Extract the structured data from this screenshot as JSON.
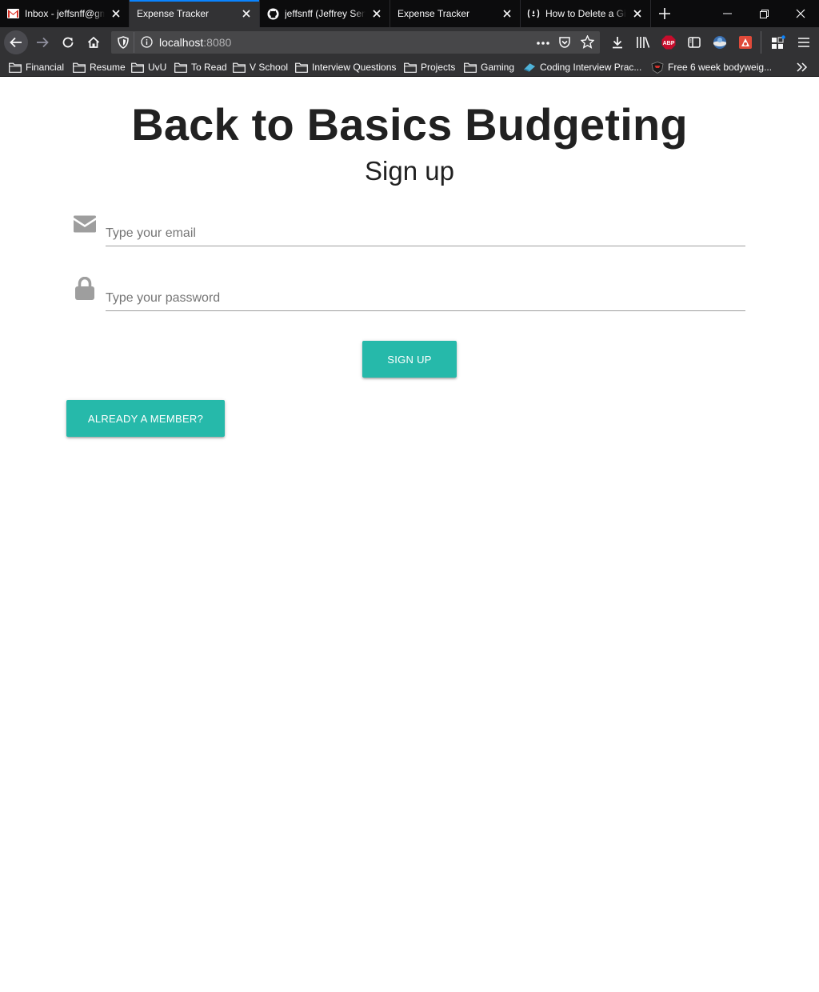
{
  "browser": {
    "tabs": [
      {
        "title": "Inbox - jeffsnff@gmail.com",
        "icon": "gmail-icon",
        "active": false
      },
      {
        "title": "Expense Tracker",
        "icon": "",
        "active": true
      },
      {
        "title": "jeffsnff (Jeffrey Senff)",
        "icon": "github-icon",
        "active": false
      },
      {
        "title": "Expense Tracker",
        "icon": "",
        "active": false
      },
      {
        "title": "How to Delete a Git Branch",
        "icon": "freecodecamp-icon",
        "active": false
      }
    ],
    "url_host": "localhost",
    "url_port": ":8080",
    "bookmarks": [
      {
        "label": "Financial"
      },
      {
        "label": "Resume"
      },
      {
        "label": "UvU"
      },
      {
        "label": "To Read"
      },
      {
        "label": "V School"
      },
      {
        "label": "Interview Questions"
      },
      {
        "label": "Projects"
      },
      {
        "label": "Gaming"
      },
      {
        "label": "Coding Interview Prac..."
      },
      {
        "label": "Free 6 week bodyweig..."
      }
    ],
    "accent_color": "#0a84ff"
  },
  "page": {
    "title": "Back to Basics Budgeting",
    "subtitle": "Sign up",
    "email_placeholder": "Type your email",
    "password_placeholder": "Type your password",
    "signup_label": "Sign Up",
    "member_label": "Already a member?",
    "button_color": "#26b9aa"
  }
}
